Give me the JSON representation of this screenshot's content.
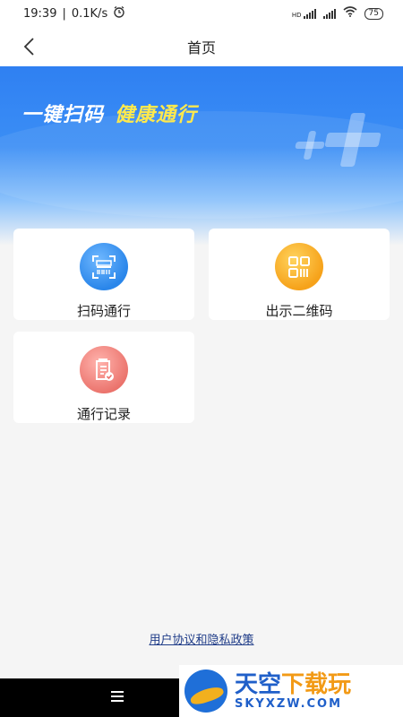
{
  "status_bar": {
    "time": "19:39",
    "separator": "|",
    "net_speed": "0.1K/s",
    "hd_label": "HD",
    "battery": "75"
  },
  "nav": {
    "title": "首页",
    "back_icon": "chevron-left-icon"
  },
  "banner": {
    "slogan_main": "一键扫码",
    "slogan_accent": "健康通行",
    "accent_color": "#ffe94d",
    "bg_color": "#2f80f2"
  },
  "cards": [
    {
      "label": "扫码通行",
      "icon": "scan-icon",
      "color": "#2a86ea"
    },
    {
      "label": "出示二维码",
      "icon": "qr-code-icon",
      "color": "#f6a21a"
    },
    {
      "label": "通行记录",
      "icon": "record-icon",
      "color": "#ea716a"
    }
  ],
  "footer": {
    "policy_link": "用户协议和隐私政策"
  },
  "watermark": {
    "cn_part1": "天空",
    "cn_part2": "下载玩",
    "en": "SKYXZW.COM"
  }
}
